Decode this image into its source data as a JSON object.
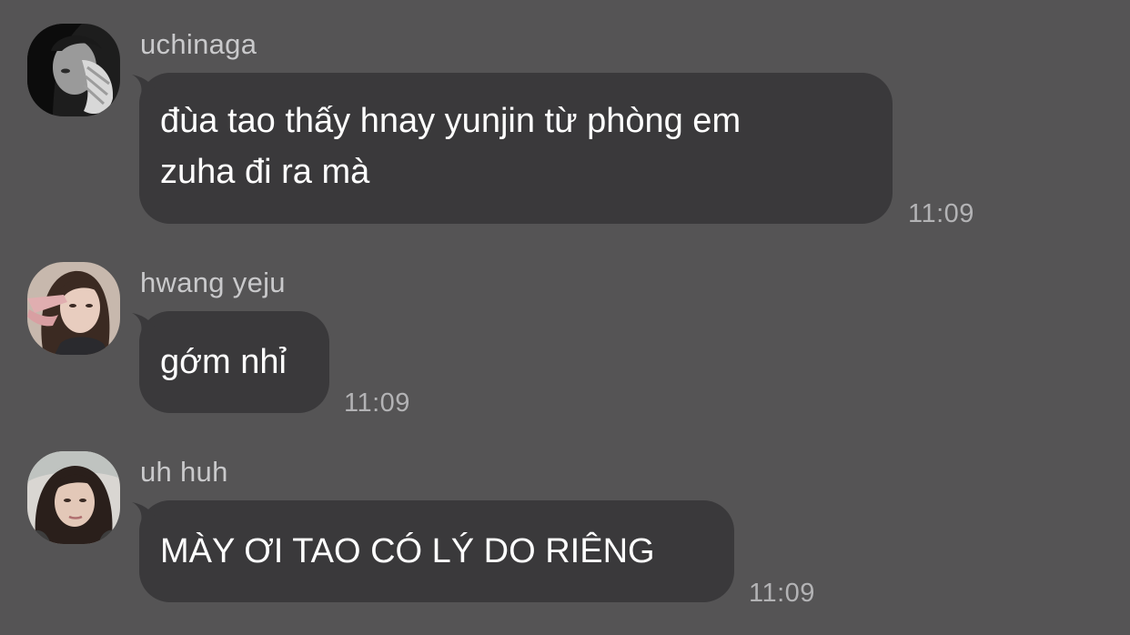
{
  "messages": [
    {
      "sender": "uchinaga",
      "text": "đùa tao thấy hnay yunjin từ phòng em\nzuha đi ra mà",
      "time": "11:09"
    },
    {
      "sender": "hwang yeju",
      "text": "gớm nhỉ",
      "time": "11:09"
    },
    {
      "sender": "uh huh",
      "text": "MÀY ƠI TAO CÓ LÝ DO RIÊNG",
      "time": "11:09"
    }
  ],
  "colors": {
    "background": "#555455",
    "bubble": "#3a393b",
    "sender": "#c9c9cb",
    "timestamp": "#b3b3b5",
    "message_text": "#ffffff"
  },
  "icons": [
    "avatar-photo-uchinaga",
    "avatar-photo-hwang-yeju",
    "avatar-photo-uh-huh"
  ]
}
